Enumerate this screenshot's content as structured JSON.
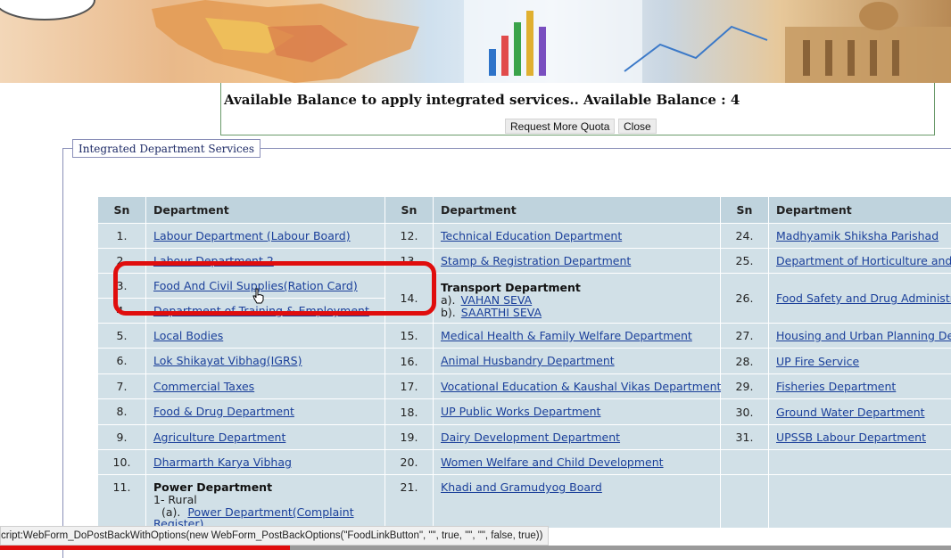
{
  "balance": {
    "apply_text": "Available Balance to apply integrated services..",
    "balance_text": "Available Balance : 4",
    "request_button": "Request More Quota",
    "close_button": "Close"
  },
  "fieldset_legend": "Integrated Department Services",
  "table": {
    "headers": [
      "Sn",
      "Department",
      "Sn",
      "Department",
      "Sn",
      "Department"
    ],
    "col1": [
      {
        "sn": "1.",
        "dept": "Labour Department (Labour Board)"
      },
      {
        "sn": "2.",
        "dept": "Labour Department 2"
      },
      {
        "sn": "3.",
        "dept": "Food And Civil Supplies(Ration Card)"
      },
      {
        "sn": "4.",
        "dept": "Department of Training & Employment"
      },
      {
        "sn": "5.",
        "dept": "Local Bodies"
      },
      {
        "sn": "6.",
        "dept": "Lok Shikayat Vibhag(IGRS)"
      },
      {
        "sn": "7.",
        "dept": "Commercial Taxes"
      },
      {
        "sn": "8.",
        "dept": "Food & Drug Department"
      },
      {
        "sn": "9.",
        "dept": "Agriculture Department"
      },
      {
        "sn": "10.",
        "dept": "Dharmarth Karya Vibhag"
      },
      {
        "sn": "11.",
        "dept": "Power Department",
        "sub1": "1- Rural",
        "sub2_prefix": "(a).",
        "sub2_link": "Power Department(Complaint",
        "sub3_link": "Register)"
      }
    ],
    "col2": [
      {
        "sn": "12.",
        "dept": "Technical Education Department"
      },
      {
        "sn": "13.",
        "dept": "Stamp & Registration Department"
      },
      {
        "sn": "14.",
        "dept": "Transport Department",
        "sub_a_prefix": "a).",
        "sub_a": "VAHAN SEVA",
        "sub_b_prefix": "b).",
        "sub_b": "SAARTHI SEVA"
      },
      {
        "sn": "15.",
        "dept": "Medical Health & Family Welfare Department"
      },
      {
        "sn": "16.",
        "dept": "Animal Husbandry Department"
      },
      {
        "sn": "17.",
        "dept": "Vocational Education & Kaushal Vikas Department"
      },
      {
        "sn": "18.",
        "dept": "UP Public Works Department"
      },
      {
        "sn": "19.",
        "dept": "Dairy Development Department"
      },
      {
        "sn": "20.",
        "dept": "Women Welfare and Child Development"
      },
      {
        "sn": "21.",
        "dept": "Khadi and Gramudyog Board"
      }
    ],
    "col3": [
      {
        "sn": "24.",
        "dept": "Madhyamik Shiksha Parishad"
      },
      {
        "sn": "25.",
        "dept": "Department of Horticulture and Fo"
      },
      {
        "sn": "26.",
        "dept": "Food Safety and Drug Administrat"
      },
      {
        "sn": "27.",
        "dept": "Housing and Urban Planning Depa"
      },
      {
        "sn": "28.",
        "dept": "UP Fire Service"
      },
      {
        "sn": "29.",
        "dept": "Fisheries Department"
      },
      {
        "sn": "30.",
        "dept": "Ground Water Department"
      },
      {
        "sn": "31.",
        "dept": "UPSSB Labour Department"
      }
    ]
  },
  "statusbar": "cript:WebForm_DoPostBackWithOptions(new WebForm_PostBackOptions(\"FoodLinkButton\", \"\", true, \"\", \"\", false, true))",
  "video_progress": 0.305,
  "colors": {
    "header_bg": "#bfd3dd",
    "row_bg": "#d1e0e7",
    "link": "#1a3f9a",
    "annotation": "#e00d0d"
  }
}
